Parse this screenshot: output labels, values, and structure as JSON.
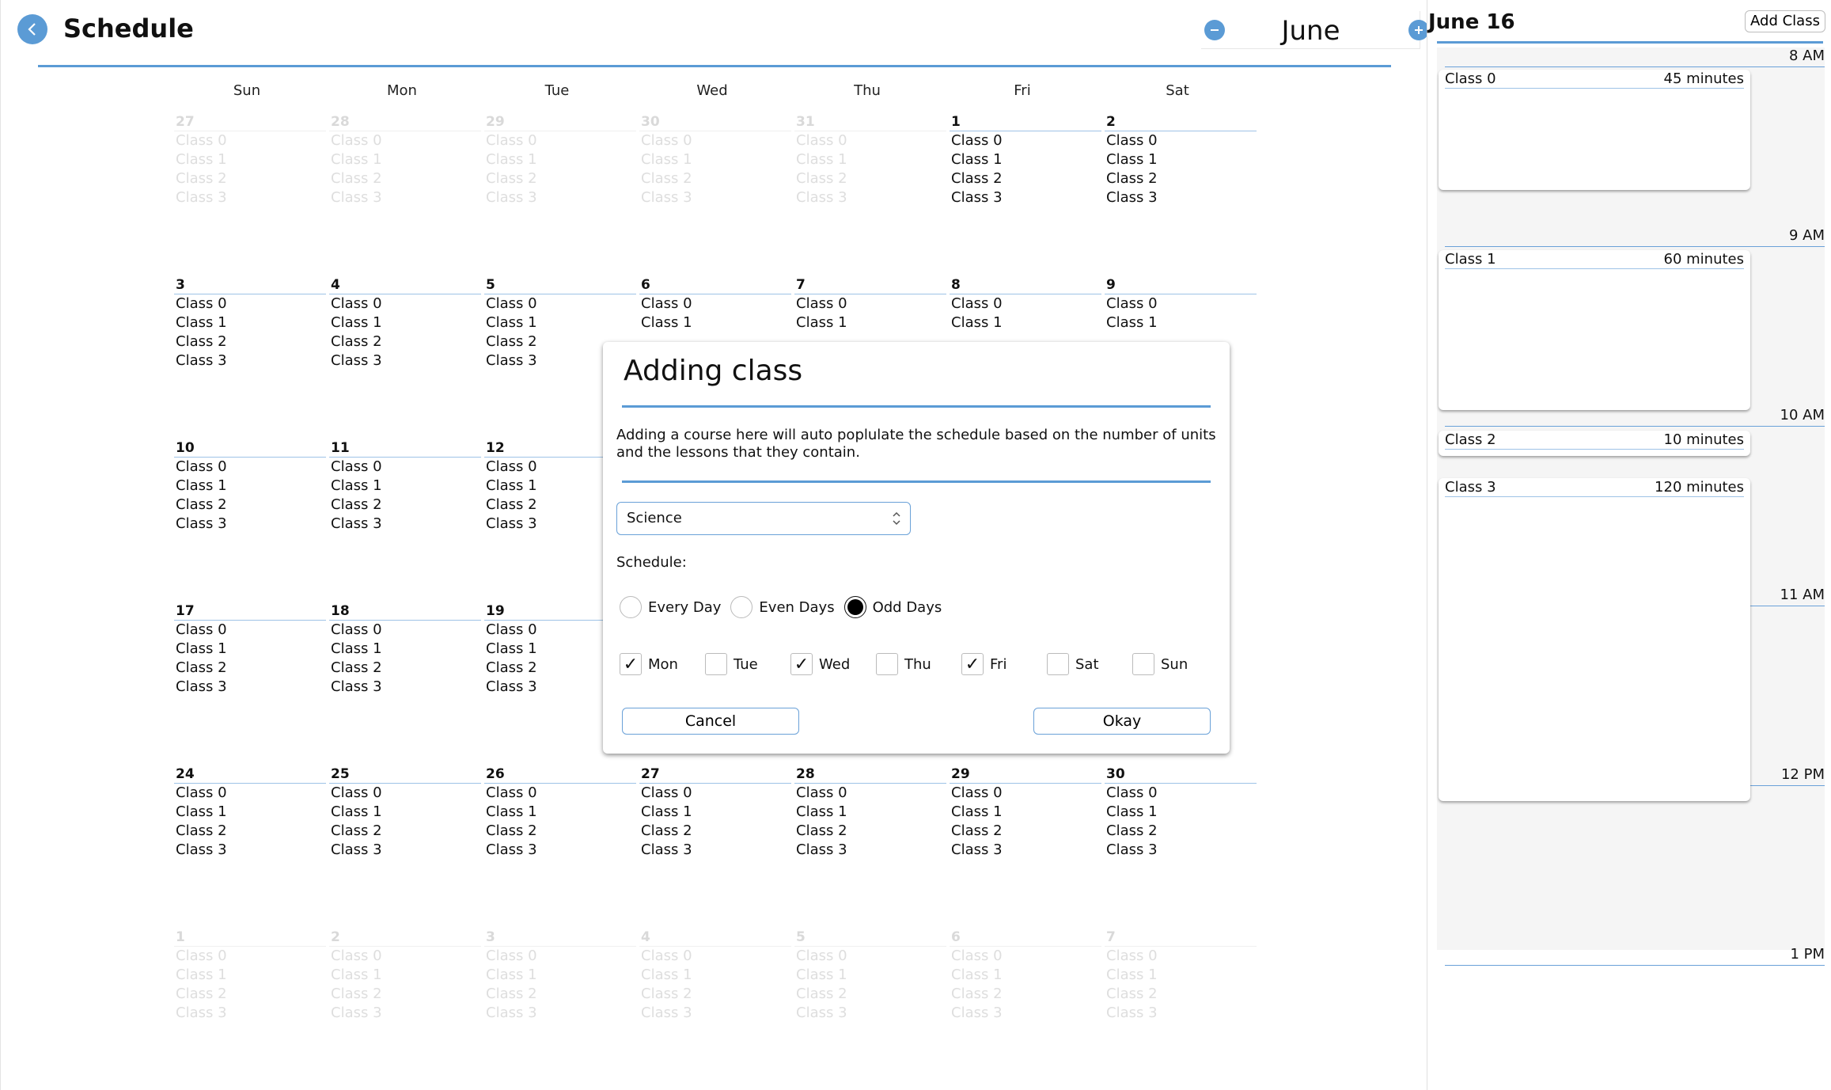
{
  "header": {
    "title": "Schedule",
    "back_icon": "chevron-left-icon",
    "month": "June",
    "prev_icon": "minus-icon",
    "next_icon": "plus-icon"
  },
  "calendar": {
    "weekdays": [
      "Sun",
      "Mon",
      "Tue",
      "Wed",
      "Thu",
      "Fri",
      "Sat"
    ],
    "weeks": [
      [
        {
          "day": "27",
          "dim": true,
          "classes": [
            "Class 0",
            "Class 1",
            "Class 2",
            "Class 3"
          ]
        },
        {
          "day": "28",
          "dim": true,
          "classes": [
            "Class 0",
            "Class 1",
            "Class 2",
            "Class 3"
          ]
        },
        {
          "day": "29",
          "dim": true,
          "classes": [
            "Class 0",
            "Class 1",
            "Class 2",
            "Class 3"
          ]
        },
        {
          "day": "30",
          "dim": true,
          "classes": [
            "Class 0",
            "Class 1",
            "Class 2",
            "Class 3"
          ]
        },
        {
          "day": "31",
          "dim": true,
          "classes": [
            "Class 0",
            "Class 1",
            "Class 2",
            "Class 3"
          ]
        },
        {
          "day": "1",
          "dim": false,
          "classes": [
            "Class 0",
            "Class 1",
            "Class 2",
            "Class 3"
          ]
        },
        {
          "day": "2",
          "dim": false,
          "classes": [
            "Class 0",
            "Class 1",
            "Class 2",
            "Class 3"
          ]
        }
      ],
      [
        {
          "day": "3",
          "dim": false,
          "classes": [
            "Class 0",
            "Class 1",
            "Class 2",
            "Class 3"
          ]
        },
        {
          "day": "4",
          "dim": false,
          "classes": [
            "Class 0",
            "Class 1",
            "Class 2",
            "Class 3"
          ]
        },
        {
          "day": "5",
          "dim": false,
          "classes": [
            "Class 0",
            "Class 1",
            "Class 2",
            "Class 3"
          ]
        },
        {
          "day": "6",
          "dim": false,
          "classes": [
            "Class 0",
            "Class 1"
          ]
        },
        {
          "day": "7",
          "dim": false,
          "classes": [
            "Class 0",
            "Class 1"
          ]
        },
        {
          "day": "8",
          "dim": false,
          "classes": [
            "Class 0",
            "Class 1"
          ]
        },
        {
          "day": "9",
          "dim": false,
          "classes": [
            "Class 0",
            "Class 1"
          ]
        }
      ],
      [
        {
          "day": "10",
          "dim": false,
          "classes": [
            "Class 0",
            "Class 1",
            "Class 2",
            "Class 3"
          ]
        },
        {
          "day": "11",
          "dim": false,
          "classes": [
            "Class 0",
            "Class 1",
            "Class 2",
            "Class 3"
          ]
        },
        {
          "day": "12",
          "dim": false,
          "classes": [
            "Class 0",
            "Class 1",
            "Class 2",
            "Class 3"
          ]
        }
      ],
      [
        {
          "day": "17",
          "dim": false,
          "classes": [
            "Class 0",
            "Class 1",
            "Class 2",
            "Class 3"
          ]
        },
        {
          "day": "18",
          "dim": false,
          "classes": [
            "Class 0",
            "Class 1",
            "Class 2",
            "Class 3"
          ]
        },
        {
          "day": "19",
          "dim": false,
          "classes": [
            "Class 0",
            "Class 1",
            "Class 2",
            "Class 3"
          ]
        }
      ],
      [
        {
          "day": "24",
          "dim": false,
          "classes": [
            "Class 0",
            "Class 1",
            "Class 2",
            "Class 3"
          ]
        },
        {
          "day": "25",
          "dim": false,
          "classes": [
            "Class 0",
            "Class 1",
            "Class 2",
            "Class 3"
          ]
        },
        {
          "day": "26",
          "dim": false,
          "classes": [
            "Class 0",
            "Class 1",
            "Class 2",
            "Class 3"
          ]
        },
        {
          "day": "27",
          "dim": false,
          "classes": [
            "Class 0",
            "Class 1",
            "Class 2",
            "Class 3"
          ]
        },
        {
          "day": "28",
          "dim": false,
          "classes": [
            "Class 0",
            "Class 1",
            "Class 2",
            "Class 3"
          ]
        },
        {
          "day": "29",
          "dim": false,
          "classes": [
            "Class 0",
            "Class 1",
            "Class 2",
            "Class 3"
          ]
        },
        {
          "day": "30",
          "dim": false,
          "classes": [
            "Class 0",
            "Class 1",
            "Class 2",
            "Class 3"
          ]
        }
      ],
      [
        {
          "day": "1",
          "dim": true,
          "classes": [
            "Class 0",
            "Class 1",
            "Class 2",
            "Class 3"
          ]
        },
        {
          "day": "2",
          "dim": true,
          "classes": [
            "Class 0",
            "Class 1",
            "Class 2",
            "Class 3"
          ]
        },
        {
          "day": "3",
          "dim": true,
          "classes": [
            "Class 0",
            "Class 1",
            "Class 2",
            "Class 3"
          ]
        },
        {
          "day": "4",
          "dim": true,
          "classes": [
            "Class 0",
            "Class 1",
            "Class 2",
            "Class 3"
          ]
        },
        {
          "day": "5",
          "dim": true,
          "classes": [
            "Class 0",
            "Class 1",
            "Class 2",
            "Class 3"
          ]
        },
        {
          "day": "6",
          "dim": true,
          "classes": [
            "Class 0",
            "Class 1",
            "Class 2",
            "Class 3"
          ]
        },
        {
          "day": "7",
          "dim": true,
          "classes": [
            "Class 0",
            "Class 1",
            "Class 2",
            "Class 3"
          ]
        }
      ]
    ]
  },
  "day_panel": {
    "title": "June 16",
    "add_button": "Add Class",
    "hours": [
      "8 AM",
      "9 AM",
      "10 AM",
      "11 AM",
      "12 PM",
      "1 PM"
    ],
    "events": [
      {
        "name": "Class 0",
        "duration": "45 minutes"
      },
      {
        "name": "Class 1",
        "duration": "60 minutes"
      },
      {
        "name": "Class 2",
        "duration": "10 minutes"
      },
      {
        "name": "Class 3",
        "duration": "120 minutes"
      }
    ]
  },
  "modal": {
    "title": "Adding class",
    "description": "Adding a course here will auto poplulate the schedule based on the number of units and the lessons that they contain.",
    "course_value": "Science",
    "schedule_label": "Schedule:",
    "radio_options": [
      {
        "label": "Every Day",
        "selected": false
      },
      {
        "label": "Even Days",
        "selected": false
      },
      {
        "label": "Odd Days",
        "selected": true
      }
    ],
    "days": [
      {
        "label": "Mon",
        "checked": true
      },
      {
        "label": "Tue",
        "checked": false
      },
      {
        "label": "Wed",
        "checked": true
      },
      {
        "label": "Thu",
        "checked": false
      },
      {
        "label": "Fri",
        "checked": true
      },
      {
        "label": "Sat",
        "checked": false
      },
      {
        "label": "Sun",
        "checked": false
      }
    ],
    "cancel_label": "Cancel",
    "okay_label": "Okay"
  }
}
